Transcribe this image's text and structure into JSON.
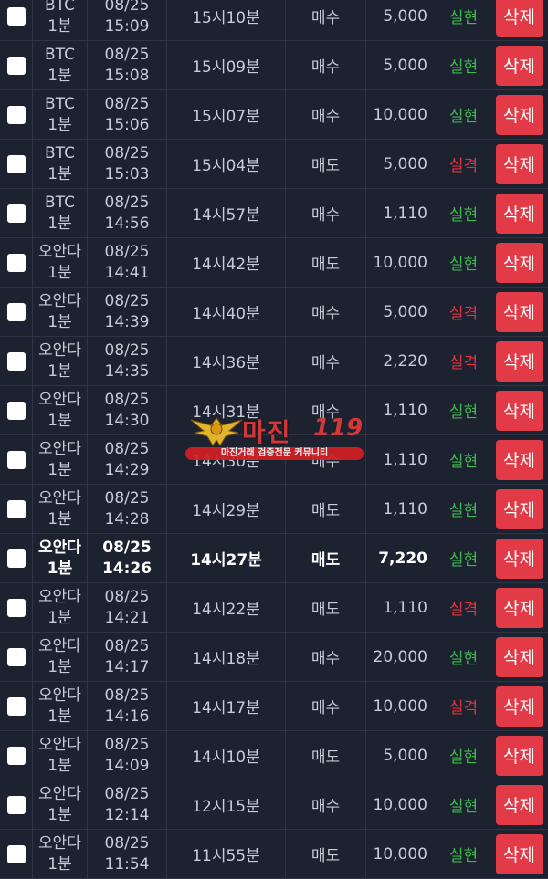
{
  "rows": [
    {
      "symbol": "BTC",
      "period": "1분",
      "date": "08/25",
      "time": "15:09",
      "round": "15시10분",
      "direction": "매수",
      "amount": "5,000",
      "result": "실현",
      "result_type": "win",
      "delete_label": "삭제"
    },
    {
      "symbol": "BTC",
      "period": "1분",
      "date": "08/25",
      "time": "15:08",
      "round": "15시09분",
      "direction": "매수",
      "amount": "5,000",
      "result": "실현",
      "result_type": "win",
      "delete_label": "삭제"
    },
    {
      "symbol": "BTC",
      "period": "1분",
      "date": "08/25",
      "time": "15:06",
      "round": "15시07분",
      "direction": "매수",
      "amount": "10,000",
      "result": "실현",
      "result_type": "win",
      "delete_label": "삭제"
    },
    {
      "symbol": "BTC",
      "period": "1분",
      "date": "08/25",
      "time": "15:03",
      "round": "15시04분",
      "direction": "매도",
      "amount": "5,000",
      "result": "실격",
      "result_type": "lose",
      "delete_label": "삭제"
    },
    {
      "symbol": "BTC",
      "period": "1분",
      "date": "08/25",
      "time": "14:56",
      "round": "14시57분",
      "direction": "매수",
      "amount": "1,110",
      "result": "실현",
      "result_type": "win",
      "delete_label": "삭제"
    },
    {
      "symbol": "오안다",
      "period": "1분",
      "date": "08/25",
      "time": "14:41",
      "round": "14시42분",
      "direction": "매도",
      "amount": "10,000",
      "result": "실현",
      "result_type": "win",
      "delete_label": "삭제"
    },
    {
      "symbol": "오안다",
      "period": "1분",
      "date": "08/25",
      "time": "14:39",
      "round": "14시40분",
      "direction": "매수",
      "amount": "5,000",
      "result": "실격",
      "result_type": "lose",
      "delete_label": "삭제"
    },
    {
      "symbol": "오안다",
      "period": "1분",
      "date": "08/25",
      "time": "14:35",
      "round": "14시36분",
      "direction": "매수",
      "amount": "2,220",
      "result": "실격",
      "result_type": "lose",
      "delete_label": "삭제"
    },
    {
      "symbol": "오안다",
      "period": "1분",
      "date": "08/25",
      "time": "14:30",
      "round": "14시31분",
      "direction": "매수",
      "amount": "1,110",
      "result": "실현",
      "result_type": "win",
      "delete_label": "삭제"
    },
    {
      "symbol": "오안다",
      "period": "1분",
      "date": "08/25",
      "time": "14:29",
      "round": "14시30분",
      "direction": "매수",
      "amount": "1,110",
      "result": "실현",
      "result_type": "win",
      "delete_label": "삭제"
    },
    {
      "symbol": "오안다",
      "period": "1분",
      "date": "08/25",
      "time": "14:28",
      "round": "14시29분",
      "direction": "매도",
      "amount": "1,110",
      "result": "실현",
      "result_type": "win",
      "delete_label": "삭제"
    },
    {
      "symbol": "오안다",
      "period": "1분",
      "date": "08/25",
      "time": "14:26",
      "round": "14시27분",
      "direction": "매도",
      "amount": "7,220",
      "result": "실현",
      "result_type": "win",
      "delete_label": "삭제",
      "highlight": true
    },
    {
      "symbol": "오안다",
      "period": "1분",
      "date": "08/25",
      "time": "14:21",
      "round": "14시22분",
      "direction": "매도",
      "amount": "1,110",
      "result": "실격",
      "result_type": "lose",
      "delete_label": "삭제"
    },
    {
      "symbol": "오안다",
      "period": "1분",
      "date": "08/25",
      "time": "14:17",
      "round": "14시18분",
      "direction": "매수",
      "amount": "20,000",
      "result": "실현",
      "result_type": "win",
      "delete_label": "삭제"
    },
    {
      "symbol": "오안다",
      "period": "1분",
      "date": "08/25",
      "time": "14:16",
      "round": "14시17분",
      "direction": "매수",
      "amount": "10,000",
      "result": "실격",
      "result_type": "lose",
      "delete_label": "삭제"
    },
    {
      "symbol": "오안다",
      "period": "1분",
      "date": "08/25",
      "time": "14:09",
      "round": "14시10분",
      "direction": "매도",
      "amount": "5,000",
      "result": "실현",
      "result_type": "win",
      "delete_label": "삭제"
    },
    {
      "symbol": "오안다",
      "period": "1분",
      "date": "08/25",
      "time": "12:14",
      "round": "12시15분",
      "direction": "매수",
      "amount": "10,000",
      "result": "실현",
      "result_type": "win",
      "delete_label": "삭제"
    },
    {
      "symbol": "오안다",
      "period": "1분",
      "date": "08/25",
      "time": "11:54",
      "round": "11시55분",
      "direction": "매도",
      "amount": "10,000",
      "result": "실현",
      "result_type": "win",
      "delete_label": "삭제"
    }
  ],
  "colors": {
    "background": "#1d2230",
    "win": "#3fb84c",
    "lose": "#e2333f",
    "delete_button": "#e23b47"
  },
  "watermark": {
    "title": "마진",
    "number": "119",
    "banner": "마진거래 검증전문 커뮤니티"
  }
}
